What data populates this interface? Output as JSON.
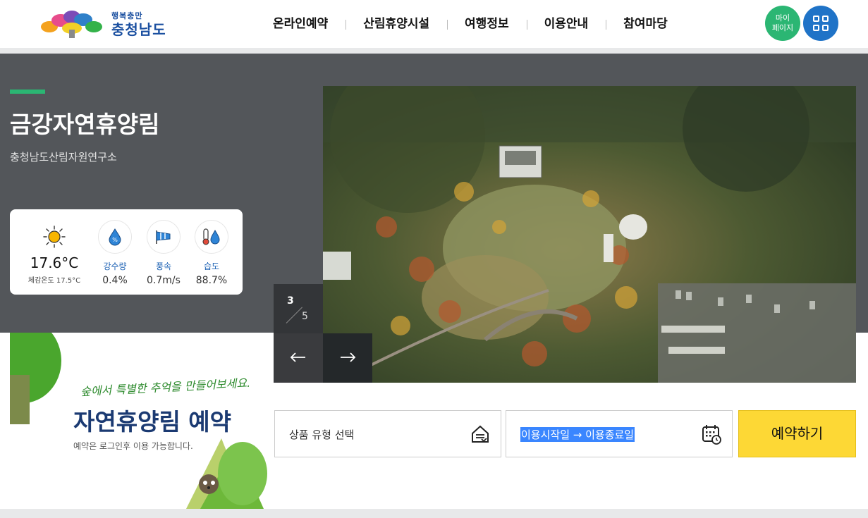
{
  "header": {
    "logo_small": "행복충만",
    "logo_big": "충청남도",
    "nav": [
      "온라인예약",
      "산림휴양시설",
      "여행정보",
      "이용안내",
      "참여마당"
    ],
    "mypage_line1": "마이",
    "mypage_line2": "페이지"
  },
  "hero": {
    "title": "금강자연휴양림",
    "subtitle": "충청남도산림자원연구소",
    "slide_current": "3",
    "slide_total": "5",
    "prev_icon": "arrow-left-icon",
    "next_icon": "arrow-right-icon"
  },
  "weather": {
    "temperature": "17.6°C",
    "feels_like": "체감온도 17.5°C",
    "precipitation_label": "강수량",
    "precipitation_value": "0.4%",
    "wind_label": "풍속",
    "wind_value": "0.7m/s",
    "humidity_label": "습도",
    "humidity_value": "88.7%"
  },
  "reservation": {
    "slogan": "숲에서 특별한 추억을 만들어보세요.",
    "title": "자연휴양림 예약",
    "note": "예약은 로그인후 이용 가능합니다.",
    "product_select": "상품 유형 선택",
    "date_range": "이용시작일 → 이용종료일",
    "reserve_button": "예약하기"
  },
  "colors": {
    "accent_green": "#2bb673",
    "accent_blue": "#1f73c7",
    "hero_bg": "#53565a",
    "button_yellow": "#fdd835"
  }
}
